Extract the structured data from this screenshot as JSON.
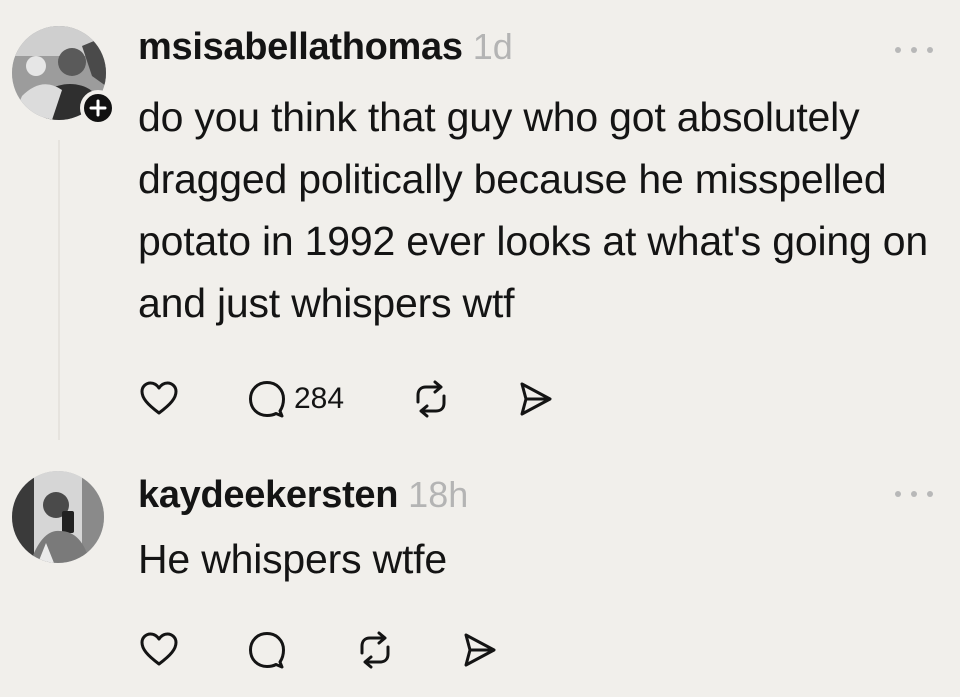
{
  "posts": [
    {
      "username": "msisabellathomas",
      "time": "1d",
      "text": "do you think that guy who got absolutely dragged politically because he misspelled potato in 1992 ever looks at what's going on and just whispers wtf",
      "reply_count": "284",
      "has_follow_badge": true
    },
    {
      "username": "kaydeekersten",
      "time": "18h",
      "text": "He whispers wtfe",
      "reply_count": ""
    }
  ],
  "icons": {
    "like": "heart-icon",
    "reply": "speech-bubble-icon",
    "repost": "repost-icon",
    "share": "send-icon",
    "more": "more-dots-icon",
    "follow": "plus-icon"
  },
  "colors": {
    "background": "#f1efeb",
    "text": "#141414",
    "timestamp": "#b4b4b4"
  }
}
